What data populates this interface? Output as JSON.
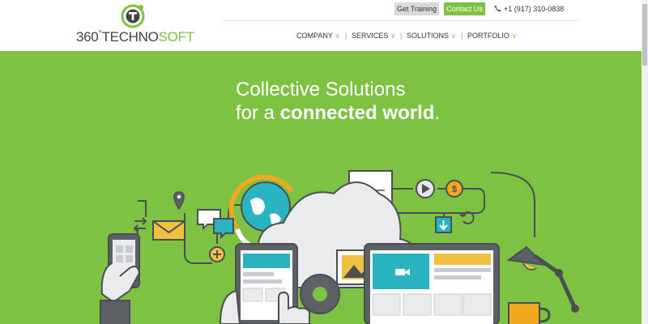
{
  "brand": {
    "prefix": "360",
    "degree": "°",
    "techno": "TECHNO",
    "soft": "SOFT"
  },
  "topbar": {
    "training_label": "Get Training",
    "contact_label": "Contact Us",
    "phone": "+1 (917) 310-0838"
  },
  "nav": [
    {
      "label": "COMPANY"
    },
    {
      "label": "SERVICES"
    },
    {
      "label": "SOLUTIONS"
    },
    {
      "label": "PORTFOLIO"
    }
  ],
  "hero": {
    "line1": "Collective Solutions",
    "line2_prefix": "for a ",
    "line2_bold": "connected world",
    "line2_suffix": "."
  },
  "colors": {
    "accent": "#7dc242",
    "hero_bg": "#7dc242",
    "text": "#333333"
  },
  "icons": [
    "logo-icon",
    "phone-icon",
    "chevron-down-icon",
    "envelope-icon",
    "location-pin-icon",
    "chat-icon",
    "globe-icon",
    "cloud-icon",
    "document-icon",
    "play-icon",
    "dollar-icon",
    "download-icon",
    "refresh-icon",
    "image-icon",
    "gear-icon",
    "lamp-icon",
    "coffee-mug-icon",
    "phone-device-icon",
    "tablet-device-icon",
    "laptop-device-icon",
    "plus-icon",
    "arrows-icon"
  ]
}
